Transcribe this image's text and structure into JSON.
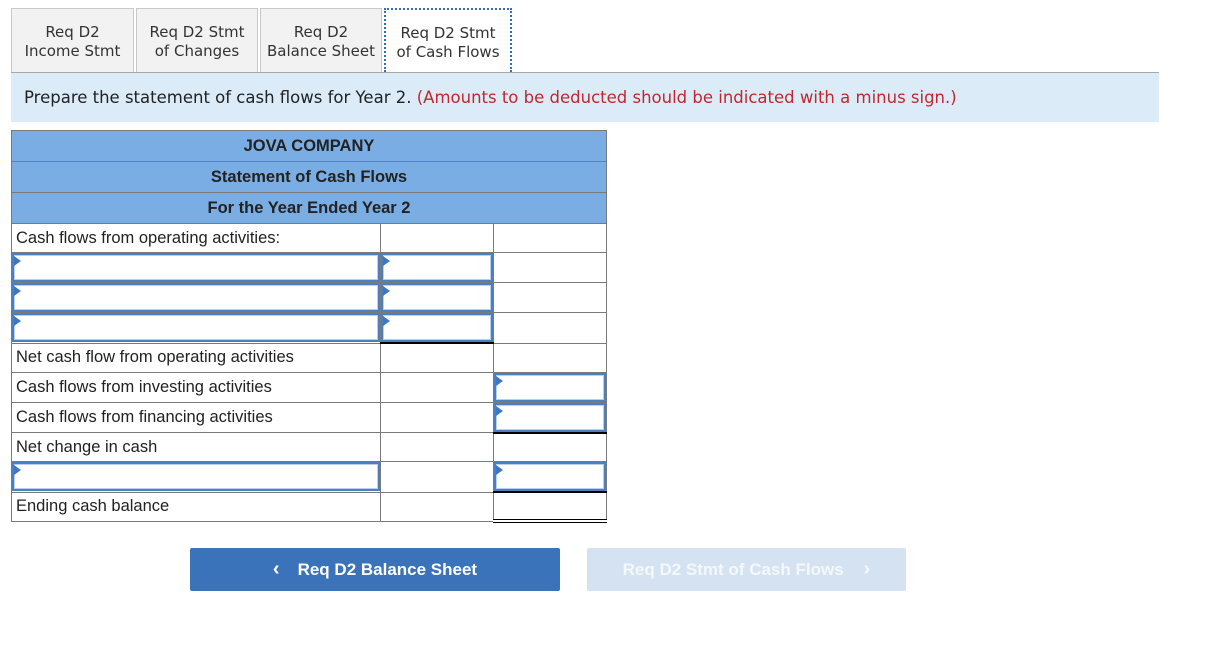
{
  "tabs": [
    {
      "line1": "Req D2",
      "line2": "Income Stmt",
      "active": false
    },
    {
      "line1": "Req D2 Stmt",
      "line2": "of Changes",
      "active": false
    },
    {
      "line1": "Req D2",
      "line2": "Balance Sheet",
      "active": false
    },
    {
      "line1": "Req D2 Stmt",
      "line2": "of Cash Flows",
      "active": true
    }
  ],
  "instruction": {
    "text": "Prepare the statement of cash flows for Year 2.",
    "note": "(Amounts to be deducted should be indicated with a minus sign.)"
  },
  "statement": {
    "company": "JOVA COMPANY",
    "title": "Statement of Cash Flows",
    "period": "For the Year Ended Year 2",
    "rows": [
      {
        "label": "Cash flows from operating activities:"
      },
      {
        "label_input": "",
        "amount_input": ""
      },
      {
        "label_input": "",
        "amount_input": ""
      },
      {
        "label_input": "",
        "amount_input": ""
      },
      {
        "label": "Net cash flow from operating activities"
      },
      {
        "label": "Cash flows from investing activities",
        "total_input": ""
      },
      {
        "label": "Cash flows from financing activities",
        "total_input": ""
      },
      {
        "label": "Net change in cash"
      },
      {
        "label_input": "",
        "total_input": ""
      },
      {
        "label": "Ending cash balance"
      }
    ]
  },
  "nav": {
    "prev_label": "Req D2 Balance Sheet",
    "next_label": "Req D2 Stmt of Cash Flows",
    "prev_icon": "‹",
    "next_icon": "›"
  },
  "colors": {
    "header_blue": "#79ade3",
    "banner_bg": "#dbebf8",
    "note_red": "#c0282d",
    "button_blue": "#3a73b9",
    "button_disabled": "#d5e2f1"
  }
}
